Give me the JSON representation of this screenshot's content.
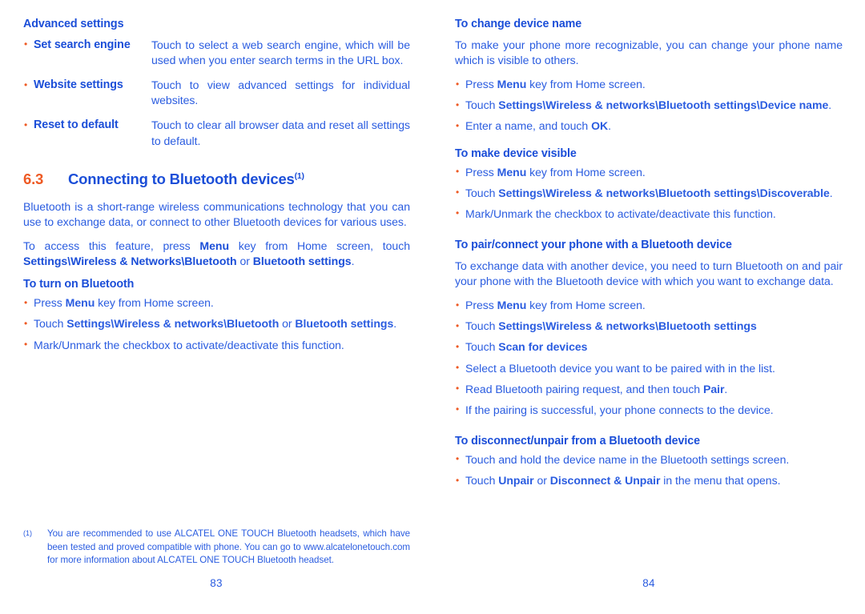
{
  "colors": {
    "text_blue": "#2a5ce0",
    "heading_blue": "#1b4ed8",
    "accent_orange": "#ee5a24"
  },
  "left_page": {
    "page_number": "83",
    "advanced_settings": {
      "heading": "Advanced settings",
      "items": [
        {
          "term": "Set search engine",
          "desc": "Touch to select a web search engine, which will be used when you enter search terms in the URL box."
        },
        {
          "term": "Website settings",
          "desc": "Touch to view advanced settings for individual websites."
        },
        {
          "term": "Reset to default",
          "desc": "Touch to clear all browser data and reset all settings to default."
        }
      ]
    },
    "section": {
      "number": "6.3",
      "title": "Connecting to Bluetooth devices",
      "footnote_marker": "(1)"
    },
    "intro_paragraph_1": "Bluetooth is a short-range wireless communications technology that you can use to exchange data, or connect to other Bluetooth devices for various uses.",
    "intro_paragraph_2": {
      "pre": "To access this feature, press ",
      "b1": "Menu",
      "mid1": " key from Home screen, touch ",
      "b2": "Settings\\Wireless & Networks\\Bluetooth",
      "mid2": " or ",
      "b3": "Bluetooth settings",
      "post": "."
    },
    "turn_on": {
      "heading": "To turn on Bluetooth",
      "bullets": [
        {
          "pre": "Press ",
          "b1": "Menu",
          "post": " key from Home screen."
        },
        {
          "pre": "Touch ",
          "b1": "Settings\\Wireless & networks\\Bluetooth",
          "mid1": " or ",
          "b2": "Bluetooth settings",
          "post": "."
        },
        {
          "pre": "Mark/Unmark the checkbox to activate/deactivate this function."
        }
      ]
    },
    "footnote": {
      "marker": "(1)",
      "text": "You are recommended to use ALCATEL ONE TOUCH Bluetooth headsets, which have been tested and proved compatible with phone. You can go to www.alcatelonetouch.com for more information about ALCATEL ONE TOUCH Bluetooth headset."
    }
  },
  "right_page": {
    "page_number": "84",
    "change_device_name": {
      "heading": "To change device name",
      "paragraph": "To make your phone more recognizable, you can change your phone name which is visible to others.",
      "bullets": [
        {
          "pre": "Press ",
          "b1": "Menu",
          "post": " key from Home screen."
        },
        {
          "pre": "Touch ",
          "b1": "Settings\\Wireless & networks\\Bluetooth settings\\Device name",
          "post": "."
        },
        {
          "pre": "Enter a name, and touch ",
          "b1": "OK",
          "post": "."
        }
      ]
    },
    "make_device_visible": {
      "heading": "To make device visible",
      "bullets": [
        {
          "pre": "Press ",
          "b1": "Menu",
          "post": " key from Home screen."
        },
        {
          "pre": "Touch ",
          "b1": "Settings\\Wireless & networks\\Bluetooth settings\\Discoverable",
          "post": "."
        },
        {
          "pre": "Mark/Unmark the checkbox to activate/deactivate this function."
        }
      ]
    },
    "pair_connect": {
      "heading": "To pair/connect your phone with a Bluetooth device",
      "paragraph": "To exchange data with another device, you need to turn Bluetooth on and pair your phone with the Bluetooth device with which you want to exchange data.",
      "bullets": [
        {
          "pre": "Press ",
          "b1": "Menu",
          "post": " key from Home screen."
        },
        {
          "pre": "Touch ",
          "b1": "Settings\\Wireless & networks\\Bluetooth settings"
        },
        {
          "pre": "Touch ",
          "b1": "Scan for devices"
        },
        {
          "pre": "Select a Bluetooth device you want to be paired with in the list."
        },
        {
          "pre": "Read Bluetooth pairing request, and then touch ",
          "b1": "Pair",
          "post": "."
        },
        {
          "pre": "If the pairing is successful, your phone connects to the device."
        }
      ]
    },
    "disconnect_unpair": {
      "heading": "To disconnect/unpair from a Bluetooth device",
      "bullets": [
        {
          "pre": "Touch and hold the device name in the Bluetooth settings screen."
        },
        {
          "pre": "Touch ",
          "b1": "Unpair",
          "mid1": " or ",
          "b2": "Disconnect & Unpair",
          "post": " in the menu that opens."
        }
      ]
    }
  }
}
